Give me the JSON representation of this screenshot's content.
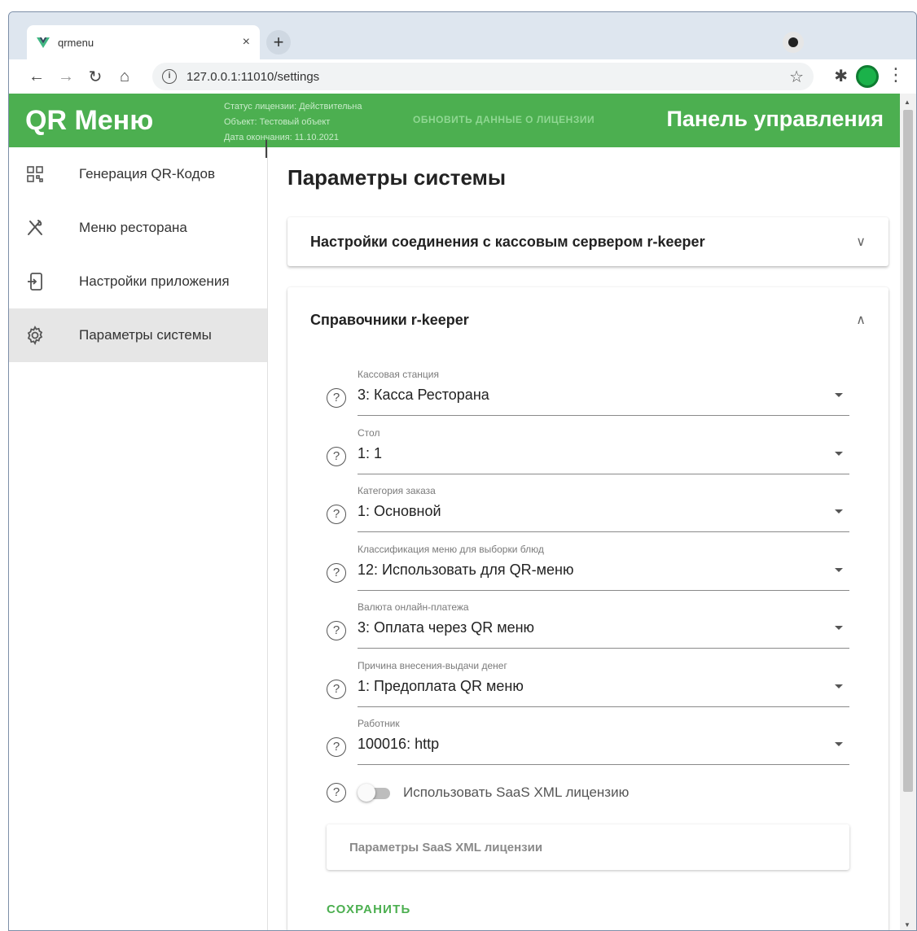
{
  "browser": {
    "tab_title": "qrmenu",
    "tab_close": "×",
    "new_tab": "+",
    "url": "127.0.0.1:11010/settings",
    "colors": {
      "brand_green": "#4caf50"
    }
  },
  "header": {
    "brand": "QR Меню",
    "license_status": "Статус лицензии: Действительна",
    "license_object": "Объект: Тестовый объект",
    "license_expiry": "Дата окончания: 11.10.2021",
    "refresh_link": "ОБНОВИТЬ ДАННЫЕ О ЛИЦЕНЗИИ",
    "panel_title": "Панель управления"
  },
  "sidebar": {
    "items": [
      {
        "label": "Генерация QR-Кодов",
        "icon": "qr-code-icon"
      },
      {
        "label": "Меню ресторана",
        "icon": "utensils-icon"
      },
      {
        "label": "Настройки приложения",
        "icon": "app-settings-icon"
      },
      {
        "label": "Параметры системы",
        "icon": "gear-icon",
        "active": true
      }
    ]
  },
  "main": {
    "title": "Параметры системы",
    "connection_panel": {
      "title": "Настройки соединения с кассовым сервером r-keeper"
    },
    "directories_panel": {
      "title": "Справочники r-keeper",
      "fields": [
        {
          "label": "Кассовая станция",
          "value": "3: Касса Ресторана"
        },
        {
          "label": "Стол",
          "value": "1: 1"
        },
        {
          "label": "Категория заказа",
          "value": "1: Основной"
        },
        {
          "label": "Классификация меню для выборки блюд",
          "value": "12: Использовать для QR-меню"
        },
        {
          "label": "Валюта онлайн-платежа",
          "value": "3: Оплата через QR меню"
        },
        {
          "label": "Причина внесения-выдачи денег",
          "value": "1: Предоплата QR меню"
        },
        {
          "label": "Работник",
          "value": "100016: http"
        }
      ],
      "saas_switch": {
        "label": "Использовать SaaS XML лицензию",
        "checked": false
      },
      "saas_params": {
        "label": "Параметры SaaS XML лицензии"
      },
      "save_label": "СОХРАНИТЬ"
    }
  }
}
